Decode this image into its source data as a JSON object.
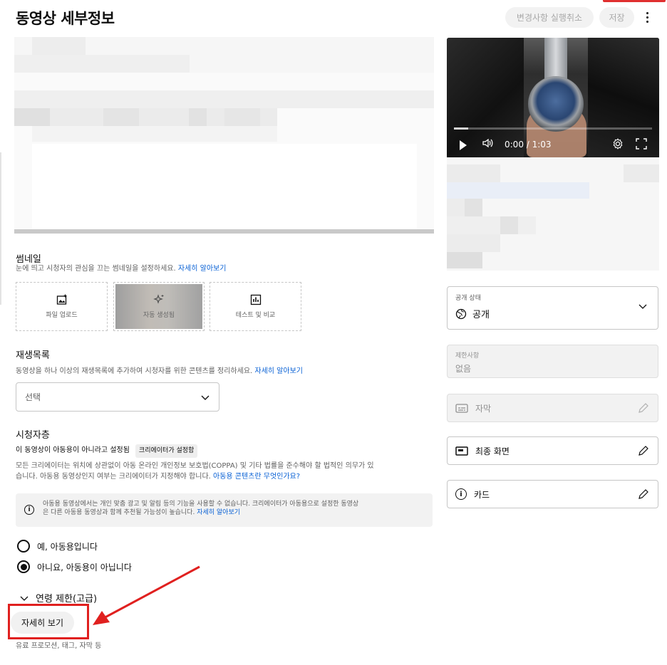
{
  "header": {
    "title": "동영상 세부정보",
    "undo_label": "변경사항 실행취소",
    "save_label": "저장"
  },
  "video": {
    "time": "0:00 / 1:03"
  },
  "thumbnail": {
    "title": "썸네일",
    "desc": "눈에 띄고 시청자의 관심을 끄는 썸네일을 설정하세요.",
    "learn_more": "자세히 알아보기",
    "options": [
      "파일 업로드",
      "자동 생성됨",
      "테스트 및 비교"
    ]
  },
  "playlist": {
    "title": "재생목록",
    "desc": "동영상을 하나 이상의 재생목록에 추가하여 시청자를 위한 콘텐츠를 정리하세요.",
    "learn_more": "자세히 알아보기",
    "select_value": "선택"
  },
  "audience": {
    "title": "시청자층",
    "status": "이 동영상이 아동용이 아니라고 설정됨",
    "badge": "크리에이터가 설정함",
    "desc_1": "모든 크리에이터는 위치에 상관없이 아동 온라인 개인정보 보호법(COPPA) 및 기타 법률을 준수해야 할 법적인 의무가 있",
    "desc_2": "습니다. 아동용 동영상인지 여부는 크리에이터가 지정해야 합니다.",
    "desc_link": "아동용 콘텐츠란 무엇인가요?",
    "info_1": "아동용 동영상에서는 개인 맞춤 광고 및 알림 등의 기능을 사용할 수 없습니다. 크리에이터가 아동용으로 설정한 동영상",
    "info_2": "은 다른 아동용 동영상과 함께 추천될 가능성이 높습니다.",
    "info_link": "자세히 알아보기",
    "option_yes": "예, 아동용입니다",
    "option_no": "아니요, 아동용이 아닙니다",
    "selected": "no",
    "age_restriction": "연령 제한(고급)"
  },
  "more": {
    "button": "자세히 보기",
    "footer": "유료 프로모션, 태그, 자막 등"
  },
  "sidebar": {
    "visibility_label": "공개 상태",
    "visibility_value": "공개",
    "restrictions_label": "제한사항",
    "restrictions_value": "없음",
    "subtitles": "자막",
    "end_screen": "최종 화면",
    "cards": "카드"
  }
}
